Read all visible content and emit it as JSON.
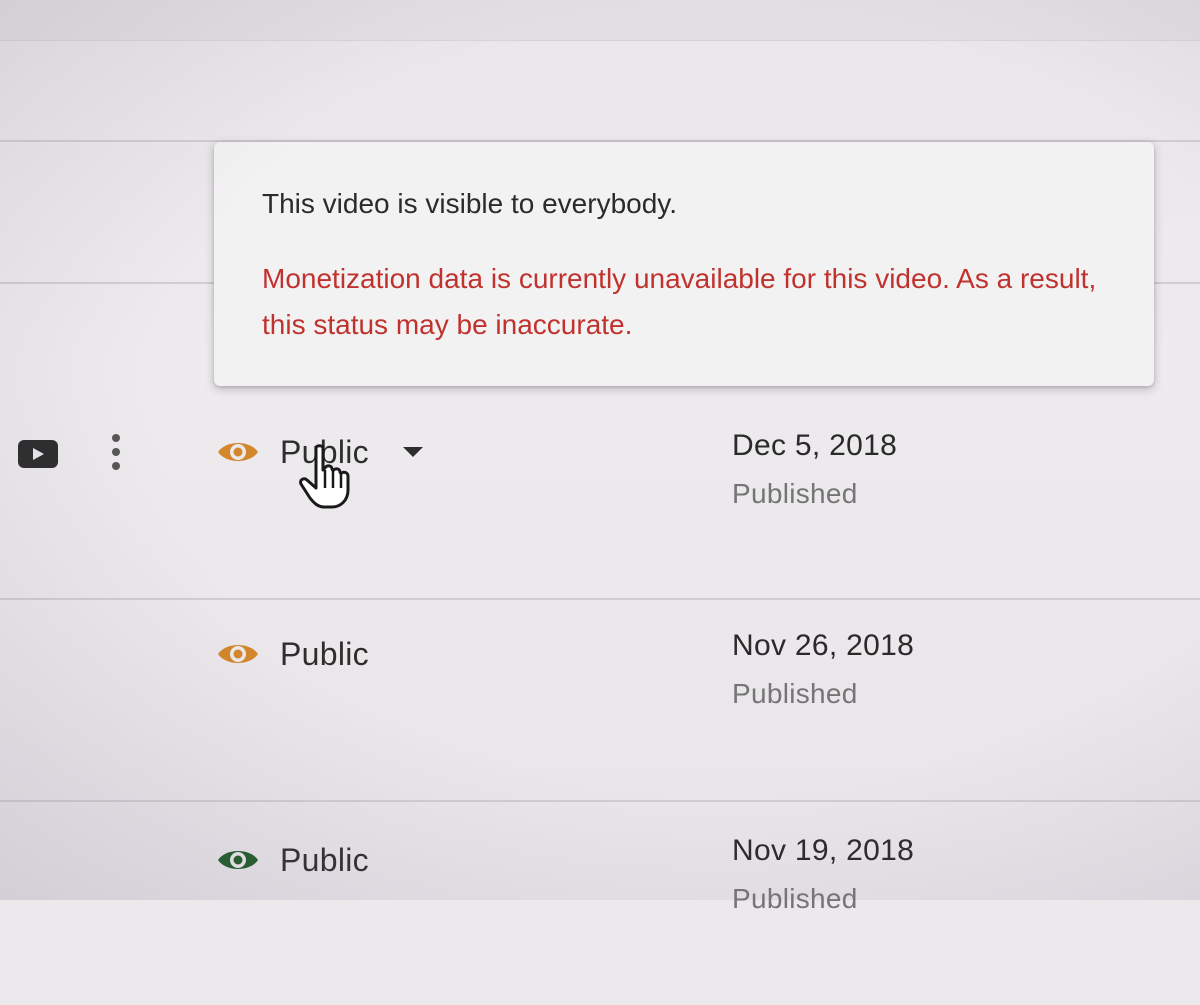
{
  "tooltip": {
    "visibility_text": "This video is visible to everybody.",
    "warning_text": "Monetization data is currently unavailable for this video. As a result, this status may be inaccurate."
  },
  "rows": [
    {
      "visibility": "Public",
      "visibility_icon": "eye-icon",
      "icon_color": "#d4862a",
      "has_dropdown": true,
      "date": "Dec 5, 2018",
      "status": "Published"
    },
    {
      "visibility": "Public",
      "visibility_icon": "eye-icon",
      "icon_color": "#d4862a",
      "has_dropdown": false,
      "date": "Nov 26, 2018",
      "status": "Published"
    },
    {
      "visibility": "Public",
      "visibility_icon": "eye-icon",
      "icon_color": "#1f5a2a",
      "has_dropdown": false,
      "date": "Nov 19, 2018",
      "status": "Published"
    }
  ],
  "colors": {
    "warning": "#c0322e",
    "monetization_limited": "#d4862a",
    "monetization_on": "#1f5a2a"
  }
}
